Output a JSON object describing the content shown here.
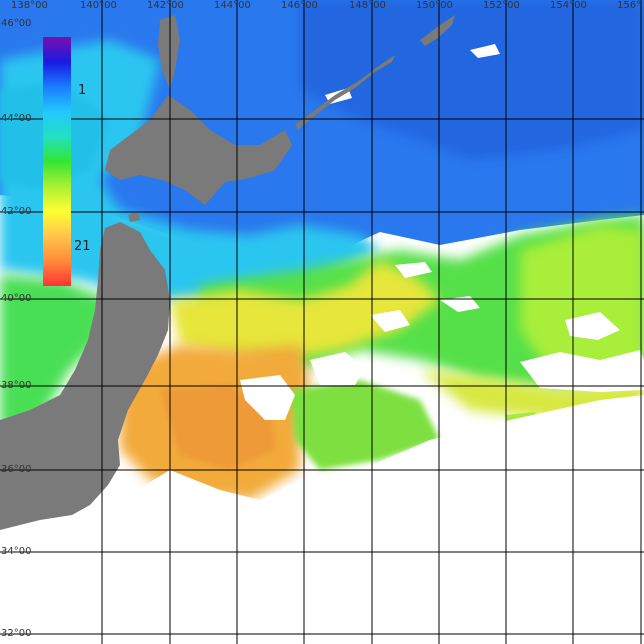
{
  "map": {
    "longitude_labels": [
      "138°00",
      "140°00",
      "142°00",
      "144°00",
      "146°00",
      "148°00",
      "150°00",
      "152°00",
      "154°00",
      "156°"
    ],
    "latitude_labels": [
      "46°00",
      "44°00",
      "42°00",
      "40°00",
      "38°00",
      "36°00",
      "34°00",
      "32°00"
    ],
    "no_data_color": "#ffffff",
    "land_color": "#7a7a7a",
    "grid_color": "#000000"
  },
  "colorbar": {
    "labels": [
      "1",
      "21"
    ],
    "colors": [
      "#7a0fb0",
      "#1a1ae0",
      "#1a7cff",
      "#22c8ff",
      "#22e0c0",
      "#33e633",
      "#aaf033",
      "#ffff33",
      "#ffc44a",
      "#ff8a3a",
      "#ff3333"
    ]
  }
}
